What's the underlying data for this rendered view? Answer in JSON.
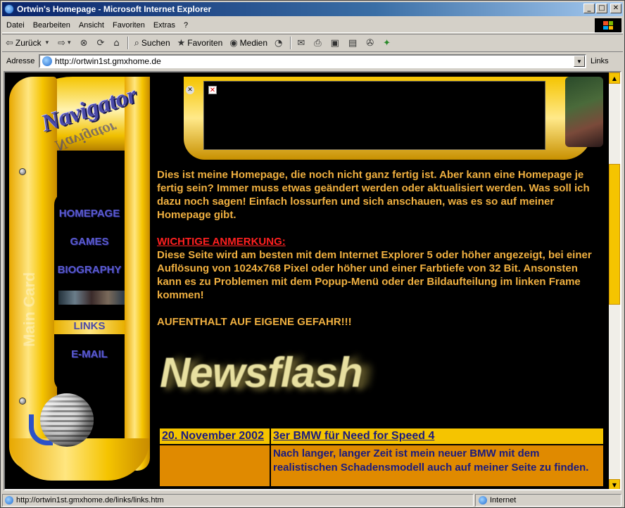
{
  "window": {
    "title": "Ortwin's Homepage - Microsoft Internet Explorer",
    "min": "_",
    "max": "□",
    "close": "✕"
  },
  "menu": [
    "Datei",
    "Bearbeiten",
    "Ansicht",
    "Favoriten",
    "Extras",
    "?"
  ],
  "toolbar": {
    "back": "Zurück",
    "search": "Suchen",
    "favorites": "Favoriten",
    "media": "Medien"
  },
  "address": {
    "label": "Adresse",
    "url": "http://ortwin1st.gmxhome.de",
    "links": "Links"
  },
  "nav": {
    "logo": "Navigator",
    "items": [
      {
        "label": "HOMEPAGE",
        "active": false
      },
      {
        "label": "GAMES",
        "active": false
      },
      {
        "label": "BIOGRAPHY",
        "active": false
      },
      {
        "label": "LINKS",
        "active": true
      },
      {
        "label": "E-MAIL",
        "active": false
      }
    ],
    "vertical_text": "Main Card"
  },
  "content": {
    "intro": "Dies ist meine Homepage, die noch nicht ganz fertig ist. Aber kann eine Homepage je fertig sein? Immer muss etwas geändert werden oder aktualisiert werden. Was soll ich dazu noch sagen! Einfach lossurfen und sich anschauen, was es so auf meiner Homepage gibt.",
    "warning_title": "WICHTIGE ANMERKUNG:",
    "warning_text": "Diese Seite wird am besten mit dem Internet Explorer 5 oder höher angezeigt, bei einer Auflösung von 1024x768 Pixel oder höher und einer Farbtiefe von 32 Bit. Ansonsten kann es zu Problemen mit dem Popup-Menü oder der Bildaufteilung im linken Frame kommen!",
    "caution": "AUFENTHALT AUF EIGENE GEFAHR!!!",
    "newsflash": "Newsflash",
    "news": [
      {
        "date": "20. November 2002",
        "headline": "3er BMW für Need for Speed 4",
        "body": "Nach langer, langer Zeit ist mein neuer BMW mit dem realistischen Schadensmodell auch auf meiner Seite zu finden."
      }
    ]
  },
  "status": {
    "url": "http://ortwin1st.gmxhome.de/links/links.htm",
    "zone": "Internet"
  }
}
